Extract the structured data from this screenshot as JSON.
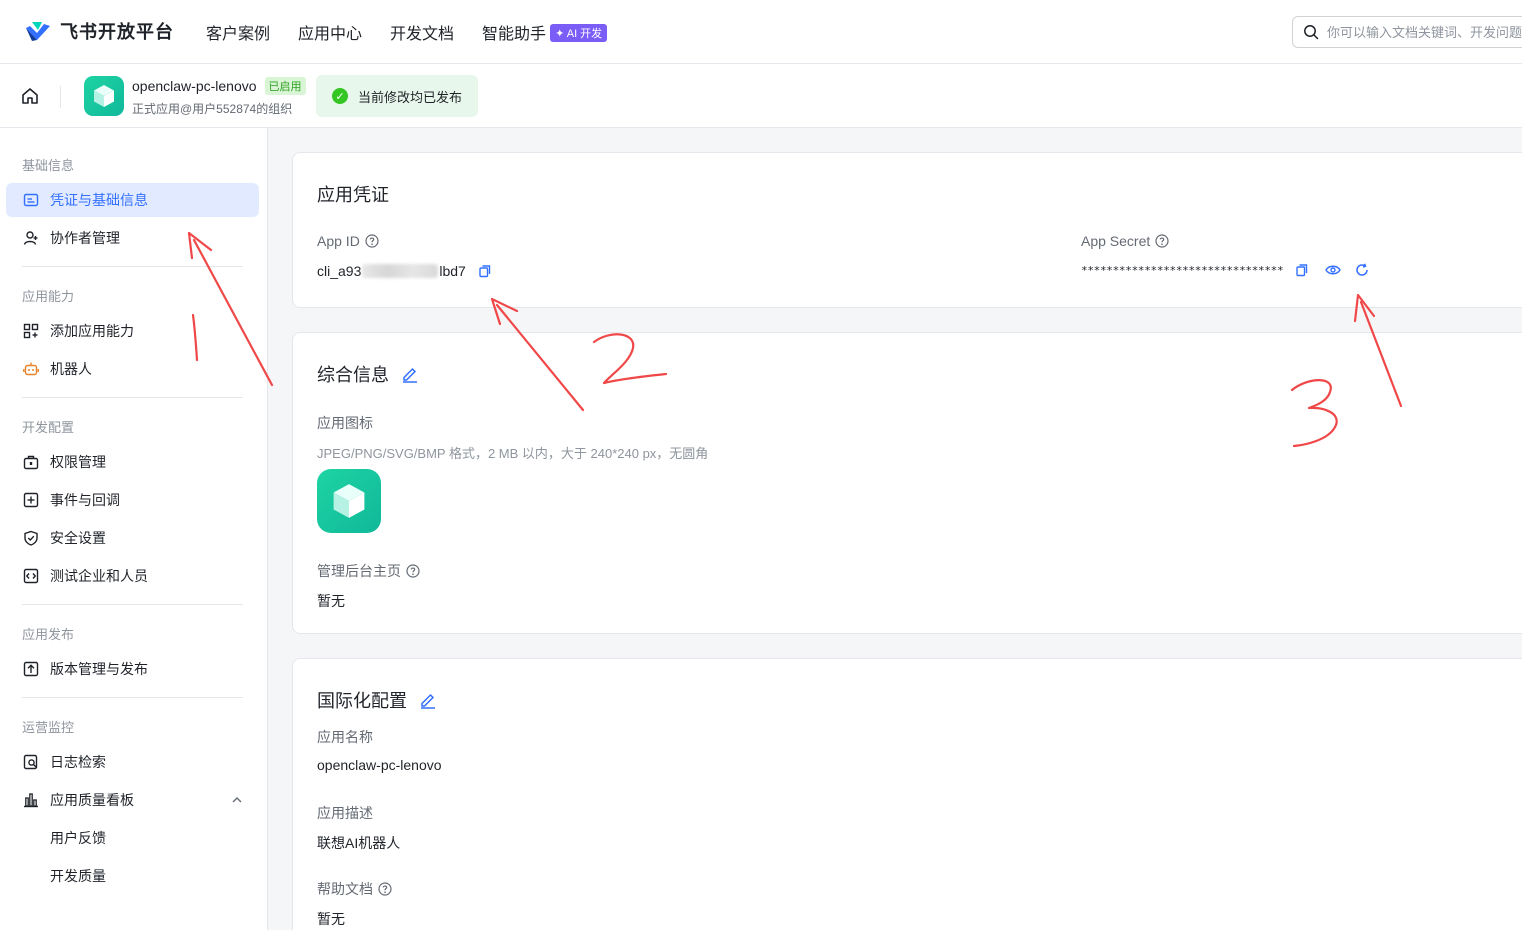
{
  "topnav": {
    "brand": "飞书开放平台",
    "links": [
      "客户案例",
      "应用中心",
      "开发文档",
      "智能助手"
    ],
    "ai_badge": "✦ AI 开发",
    "search_placeholder": "你可以输入文档关键词、开发问题"
  },
  "app": {
    "name": "openclaw-pc-lenovo",
    "status": "已启用",
    "subtitle": "正式应用@用户552874的组织",
    "publish_banner": "当前修改均已发布"
  },
  "sidebar": {
    "groups": [
      {
        "title": "基础信息",
        "items": [
          "凭证与基础信息",
          "协作者管理"
        ]
      },
      {
        "title": "应用能力",
        "items": [
          "添加应用能力",
          "机器人"
        ]
      },
      {
        "title": "开发配置",
        "items": [
          "权限管理",
          "事件与回调",
          "安全设置",
          "测试企业和人员"
        ]
      },
      {
        "title": "应用发布",
        "items": [
          "版本管理与发布"
        ]
      },
      {
        "title": "运营监控",
        "items": [
          "日志检索",
          "应用质量看板",
          "用户反馈",
          "开发质量"
        ]
      }
    ]
  },
  "credentials": {
    "title": "应用凭证",
    "app_id_label": "App ID",
    "app_id_prefix": "cli_a93",
    "app_id_suffix": "lbd7",
    "app_secret_label": "App Secret",
    "app_secret_masked": "********************************"
  },
  "general": {
    "title": "综合信息",
    "icon_label": "应用图标",
    "icon_hint": "JPEG/PNG/SVG/BMP 格式，2 MB 以内，大于 240*240 px，无圆角",
    "admin_home_label": "管理后台主页",
    "admin_home_value": "暂无"
  },
  "i18n": {
    "title": "国际化配置",
    "name_label": "应用名称",
    "name_value": "openclaw-pc-lenovo",
    "desc_label": "应用描述",
    "desc_value": "联想AI机器人",
    "help_label": "帮助文档",
    "help_value": "暂无"
  },
  "colors": {
    "accent": "#3370ff",
    "annotation": "#f04848",
    "app_icon": "#14c39e"
  }
}
